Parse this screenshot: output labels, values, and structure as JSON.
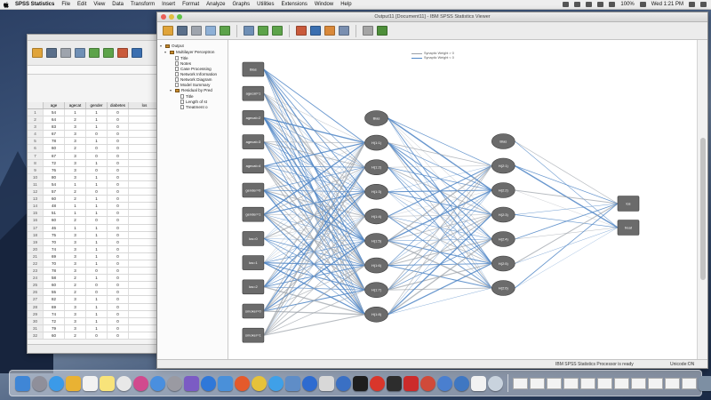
{
  "menubar": {
    "app_name": "SPSS Statistics",
    "items": [
      "File",
      "Edit",
      "View",
      "Data",
      "Transform",
      "Insert",
      "Format",
      "Analyze",
      "Graphs",
      "Utilities",
      "Extensions",
      "Window",
      "Help"
    ],
    "battery": "100%",
    "clock": "Wed 1:21 PM"
  },
  "viewer": {
    "title": "Output11 [Document11] - IBM SPSS Statistics Viewer",
    "status_text": "IBM SPSS Statistics Processor is ready",
    "encoding_text": "Unicode:ON"
  },
  "outline": {
    "root": "Output",
    "procedure": "Multilayer Perceptron",
    "items": [
      "Title",
      "Notes",
      "Case Processing",
      "Network Information",
      "Network Diagram",
      "Model Summary"
    ],
    "sub_procedure": "Residual by Pred",
    "sub_items": [
      "Title",
      "Length of st",
      "Treatment o"
    ]
  },
  "legend": {
    "positive": "Synaptic Weight > 0",
    "negative": "Synaptic Weight < 0"
  },
  "network": {
    "input_labels": [
      "Bias",
      "agecat=1",
      "agecat=2",
      "agecat=3",
      "agecat=4",
      "gender=0",
      "gender=1",
      "los=0",
      "los=1",
      "los=2",
      "smoker=0",
      "smoker=1"
    ],
    "hidden1_labels": [
      "Bias",
      "H(1:1)",
      "H(1:2)",
      "H(1:3)",
      "H(1:4)",
      "H(1:5)",
      "H(1:6)",
      "H(1:7)",
      "H(1:8)"
    ],
    "hidden2_labels": [
      "Bias",
      "H(2:1)",
      "H(2:2)",
      "H(2:3)",
      "H(2:4)",
      "H(2:5)",
      "H(2:6)"
    ],
    "output_labels": [
      "los",
      "treat"
    ]
  },
  "data_editor": {
    "columns": [
      "",
      "age",
      "agecat",
      "gender",
      "diabetes",
      "los"
    ],
    "rows": [
      [
        "1",
        "54",
        "1",
        "1",
        "0",
        ""
      ],
      [
        "2",
        "64",
        "2",
        "1",
        "0",
        ""
      ],
      [
        "3",
        "83",
        "3",
        "1",
        "0",
        ""
      ],
      [
        "4",
        "67",
        "3",
        "0",
        "0",
        ""
      ],
      [
        "5",
        "78",
        "3",
        "1",
        "0",
        ""
      ],
      [
        "6",
        "60",
        "2",
        "0",
        "0",
        ""
      ],
      [
        "7",
        "67",
        "3",
        "0",
        "0",
        ""
      ],
      [
        "8",
        "72",
        "3",
        "1",
        "0",
        ""
      ],
      [
        "9",
        "76",
        "3",
        "0",
        "0",
        ""
      ],
      [
        "10",
        "80",
        "3",
        "1",
        "0",
        ""
      ],
      [
        "11",
        "54",
        "1",
        "1",
        "0",
        ""
      ],
      [
        "12",
        "57",
        "2",
        "0",
        "0",
        ""
      ],
      [
        "13",
        "60",
        "2",
        "1",
        "0",
        ""
      ],
      [
        "14",
        "48",
        "1",
        "1",
        "0",
        ""
      ],
      [
        "15",
        "51",
        "1",
        "1",
        "0",
        ""
      ],
      [
        "16",
        "60",
        "2",
        "0",
        "0",
        ""
      ],
      [
        "17",
        "46",
        "1",
        "1",
        "0",
        ""
      ],
      [
        "18",
        "75",
        "3",
        "1",
        "0",
        ""
      ],
      [
        "19",
        "70",
        "3",
        "1",
        "0",
        ""
      ],
      [
        "20",
        "74",
        "3",
        "1",
        "0",
        ""
      ],
      [
        "21",
        "69",
        "3",
        "1",
        "0",
        ""
      ],
      [
        "22",
        "70",
        "3",
        "1",
        "0",
        ""
      ],
      [
        "23",
        "78",
        "3",
        "0",
        "0",
        ""
      ],
      [
        "24",
        "58",
        "2",
        "1",
        "0",
        ""
      ],
      [
        "25",
        "60",
        "2",
        "0",
        "0",
        ""
      ],
      [
        "26",
        "55",
        "2",
        "0",
        "0",
        ""
      ],
      [
        "27",
        "82",
        "3",
        "1",
        "0",
        ""
      ],
      [
        "28",
        "69",
        "3",
        "1",
        "0",
        ""
      ],
      [
        "29",
        "74",
        "3",
        "1",
        "0",
        ""
      ],
      [
        "30",
        "72",
        "3",
        "1",
        "0",
        ""
      ],
      [
        "31",
        "79",
        "3",
        "1",
        "0",
        ""
      ],
      [
        "32",
        "60",
        "2",
        "0",
        "0",
        ""
      ]
    ]
  },
  "colors": {
    "positive_weight": "#9aa0a8",
    "negative_weight": "#4f86c6",
    "node_fill": "#6b6b6b",
    "window_bg": "#ffffff",
    "desktop": "#344a6c"
  }
}
